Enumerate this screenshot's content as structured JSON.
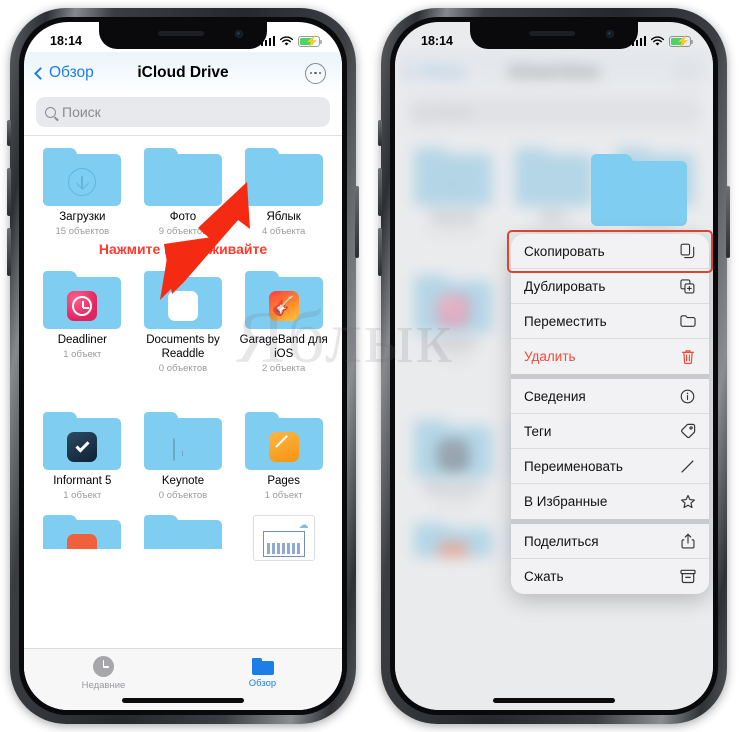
{
  "status_bar": {
    "time": "18:14",
    "signal": "cellular-bars-icon",
    "wifi": "wifi-icon",
    "battery": "battery-charging-icon"
  },
  "nav": {
    "back_label": "Обзор",
    "title": "iCloud Drive",
    "more_label": "more-options"
  },
  "search": {
    "placeholder": "Поиск"
  },
  "callout": {
    "text": "Нажмите и удерживайте"
  },
  "watermark": {
    "text": "Яблык"
  },
  "files": [
    {
      "name": "Загрузки",
      "count": "15 объектов",
      "icon": "download-folder-icon"
    },
    {
      "name": "Фото",
      "count": "9 объектов",
      "icon": "plain-folder-icon"
    },
    {
      "name": "Яблык",
      "count": "4 объекта",
      "icon": "plain-folder-icon"
    },
    {
      "name": "Deadliner",
      "count": "1 объект",
      "icon": "deadliner-app-icon"
    },
    {
      "name": "Documents by Readdle",
      "count": "0 объектов",
      "icon": "documents-readdle-app-icon"
    },
    {
      "name": "GarageBand для iOS",
      "count": "2 объекта",
      "icon": "garageband-app-icon"
    },
    {
      "name": "Informant 5",
      "count": "1 объект",
      "icon": "informant-app-icon"
    },
    {
      "name": "Keynote",
      "count": "0 объектов",
      "icon": "keynote-app-icon"
    },
    {
      "name": "Pages",
      "count": "1 объект",
      "icon": "pages-app-icon"
    }
  ],
  "tabbar": {
    "recent": {
      "label": "Недавние",
      "icon": "clock-icon",
      "active": false
    },
    "browse": {
      "label": "Обзор",
      "icon": "folder-icon",
      "active": true
    }
  },
  "context_menu": {
    "highlighted": "Скопировать",
    "groups": [
      [
        {
          "label": "Скопировать",
          "icon": "copy-icon",
          "danger": false
        },
        {
          "label": "Дублировать",
          "icon": "duplicate-icon",
          "danger": false
        },
        {
          "label": "Переместить",
          "icon": "folder-move-icon",
          "danger": false
        },
        {
          "label": "Удалить",
          "icon": "trash-icon",
          "danger": true
        }
      ],
      [
        {
          "label": "Сведения",
          "icon": "info-circle-icon",
          "danger": false
        },
        {
          "label": "Теги",
          "icon": "tag-icon",
          "danger": false
        },
        {
          "label": "Переименовать",
          "icon": "pencil-icon",
          "danger": false
        },
        {
          "label": "В Избранные",
          "icon": "star-icon",
          "danger": false
        }
      ],
      [
        {
          "label": "Поделиться",
          "icon": "share-icon",
          "danger": false
        },
        {
          "label": "Сжать",
          "icon": "compress-icon",
          "danger": false
        }
      ]
    ]
  },
  "colors": {
    "accent_blue": "#1d7ee8",
    "folder_blue": "#7fcdf0",
    "callout_red": "#ff3b2f",
    "highlight_border": "#d9452e",
    "danger_red": "#ef4b38",
    "battery_green": "#4cd464"
  }
}
